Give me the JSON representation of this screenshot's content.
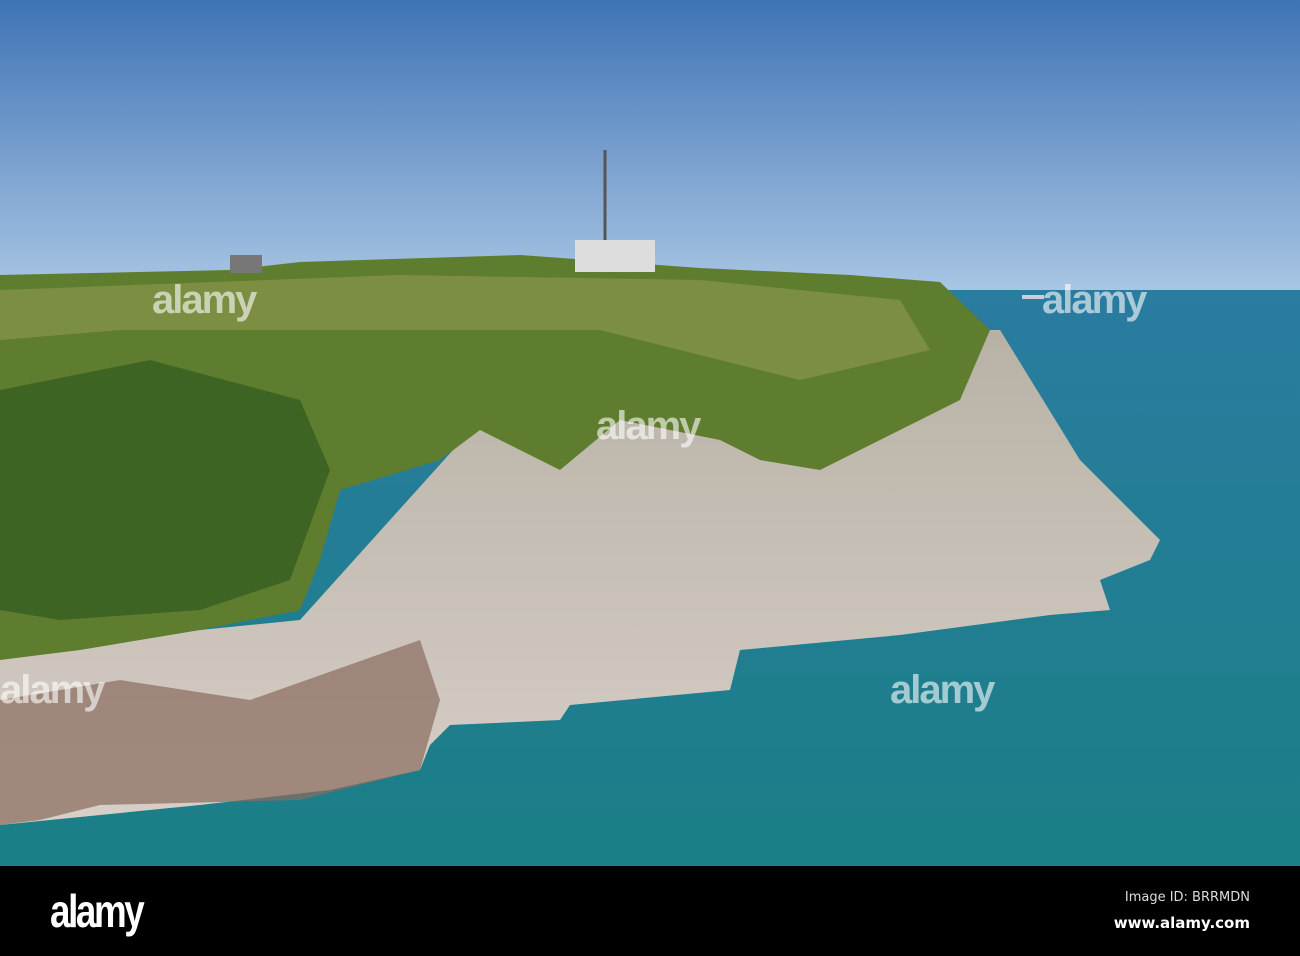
{
  "image": {
    "subject": "coastal headland",
    "colors": {
      "sky_top": "#3f73b5",
      "sky_horizon": "#a9c6e4",
      "sea": "#1f7c8a",
      "grass": "#5f7d2e",
      "rock": "#c9bfb6"
    }
  },
  "watermark": {
    "overlay_text": "alamy"
  },
  "footer": {
    "logo": "alamy",
    "image_id": "Image ID: BRRMDN",
    "url": "www.alamy.com"
  }
}
